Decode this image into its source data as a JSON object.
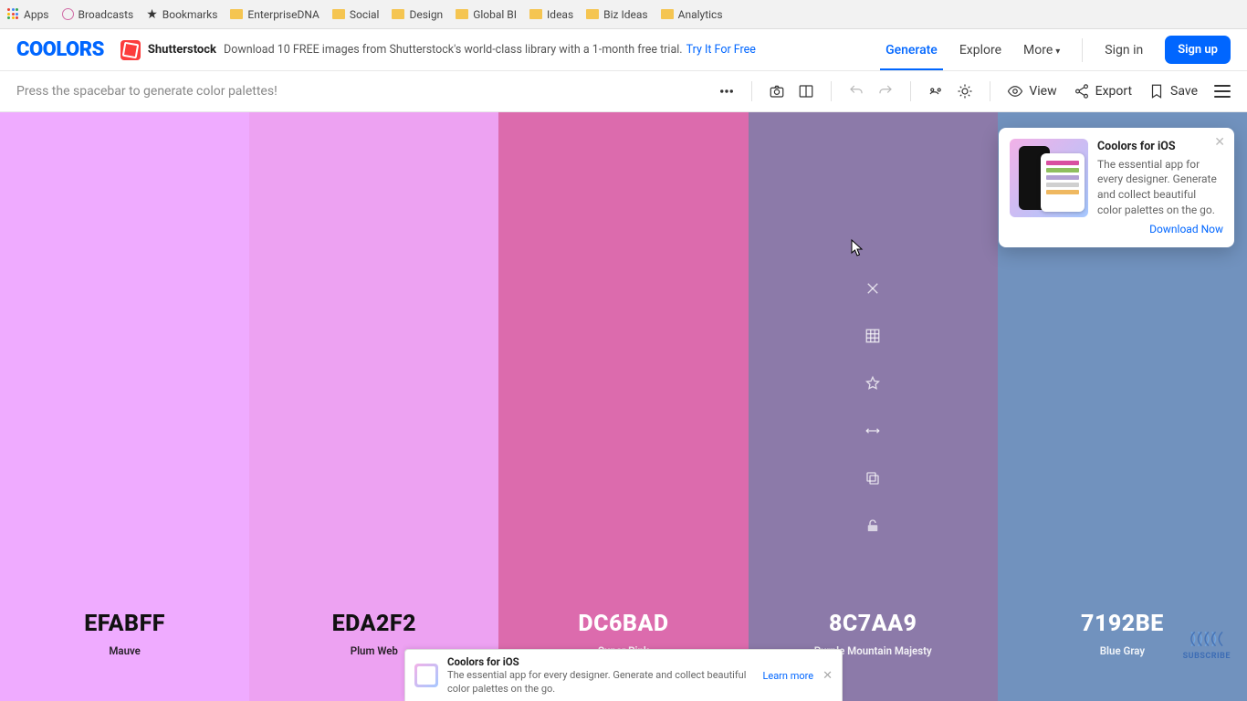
{
  "bookmarks": {
    "apps": "Apps",
    "broadcasts": "Broadcasts",
    "bookmarks": "Bookmarks",
    "folders": [
      "EnterpriseDNA",
      "Social",
      "Design",
      "Global BI",
      "Ideas",
      "Biz Ideas",
      "Analytics"
    ]
  },
  "header": {
    "logo": "COOLORS",
    "shutterstock": "Shutterstock",
    "ss_text": "Download 10 FREE images from Shutterstock's world-class library with a 1-month free trial.",
    "ss_link": "Try It For Free",
    "nav": {
      "generate": "Generate",
      "explore": "Explore",
      "more": "More"
    },
    "signin": "Sign in",
    "signup": "Sign up"
  },
  "toolbar": {
    "hint": "Press the spacebar to generate color palettes!",
    "view": "View",
    "export": "Export",
    "save": "Save"
  },
  "palette": [
    {
      "hex": "EFABFF",
      "name": "Mauve",
      "color": "#EFABFF",
      "text": "dark"
    },
    {
      "hex": "EDA2F2",
      "name": "Plum Web",
      "color": "#EDA2F2",
      "text": "dark"
    },
    {
      "hex": "DC6BAD",
      "name": "Super Pink",
      "color": "#DC6BAD",
      "text": "light"
    },
    {
      "hex": "8C7AA9",
      "name": "Purple Mountain Majesty",
      "color": "#8C7AA9",
      "text": "light",
      "hovered": true
    },
    {
      "hex": "7192BE",
      "name": "Blue Gray",
      "color": "#7192BE",
      "text": "light"
    }
  ],
  "promo": {
    "title": "Coolors for iOS",
    "body": "The essential app for every designer. Generate and collect beautiful color palettes on the go.",
    "cta": "Download Now"
  },
  "banner": {
    "title": "Coolors for iOS",
    "body": "The essential app for every designer. Generate and collect beautiful color palettes on the go.",
    "learn": "Learn more"
  },
  "subscribe": "SUBSCRIBE"
}
